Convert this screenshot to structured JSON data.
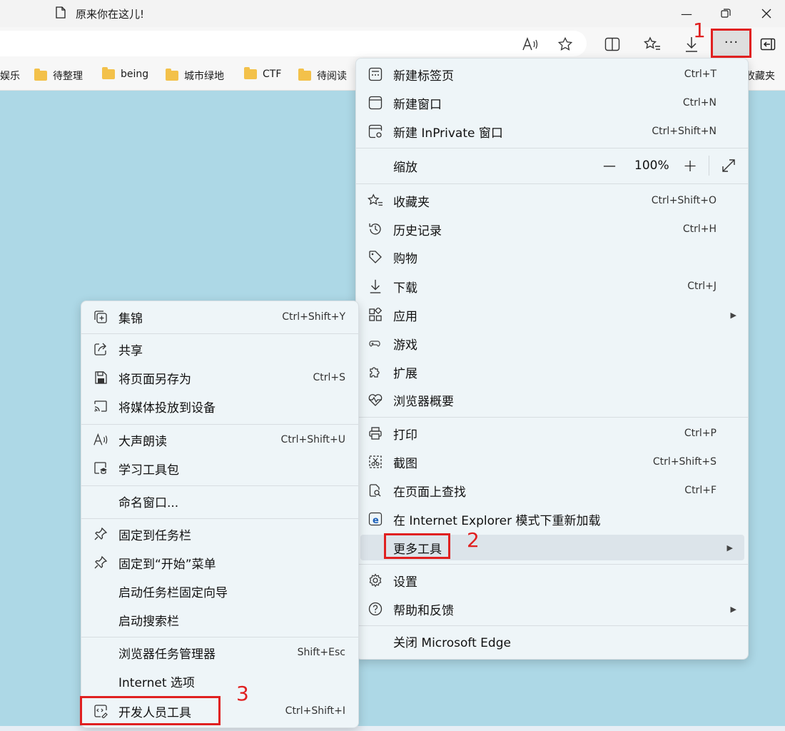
{
  "tab": {
    "title": "原来你在这儿!"
  },
  "favorites": [
    {
      "label": "娱乐"
    },
    {
      "label": "待整理"
    },
    {
      "label": "being"
    },
    {
      "label": "城市绿地"
    },
    {
      "label": "CTF"
    },
    {
      "label": "待阅读"
    },
    {
      "label": "收藏夹"
    }
  ],
  "main_menu": {
    "new_tab": {
      "label": "新建标签页",
      "shortcut": "Ctrl+T"
    },
    "new_window": {
      "label": "新建窗口",
      "shortcut": "Ctrl+N"
    },
    "new_inprivate": {
      "label": "新建 InPrivate 窗口",
      "shortcut": "Ctrl+Shift+N"
    },
    "zoom": {
      "label": "缩放",
      "value": "100%",
      "minus": "—",
      "plus": "+"
    },
    "favorites": {
      "label": "收藏夹",
      "shortcut": "Ctrl+Shift+O"
    },
    "history": {
      "label": "历史记录",
      "shortcut": "Ctrl+H"
    },
    "shopping": {
      "label": "购物"
    },
    "downloads": {
      "label": "下载",
      "shortcut": "Ctrl+J"
    },
    "apps": {
      "label": "应用"
    },
    "games": {
      "label": "游戏"
    },
    "extensions": {
      "label": "扩展"
    },
    "browser_essentials": {
      "label": "浏览器概要"
    },
    "print": {
      "label": "打印",
      "shortcut": "Ctrl+P"
    },
    "screenshot": {
      "label": "截图",
      "shortcut": "Ctrl+Shift+S"
    },
    "find": {
      "label": "在页面上查找",
      "shortcut": "Ctrl+F"
    },
    "ie_mode": {
      "label": "在 Internet Explorer 模式下重新加载"
    },
    "more_tools": {
      "label": "更多工具"
    },
    "settings": {
      "label": "设置"
    },
    "help": {
      "label": "帮助和反馈"
    },
    "close": {
      "label": "关闭 Microsoft Edge"
    }
  },
  "sub_menu": {
    "collections": {
      "label": "集锦",
      "shortcut": "Ctrl+Shift+Y"
    },
    "share": {
      "label": "共享"
    },
    "save_as": {
      "label": "将页面另存为",
      "shortcut": "Ctrl+S"
    },
    "cast": {
      "label": "将媒体投放到设备"
    },
    "read_aloud": {
      "label": "大声朗读",
      "shortcut": "Ctrl+Shift+U"
    },
    "learning": {
      "label": "学习工具包"
    },
    "name_window": {
      "label": "命名窗口..."
    },
    "pin_taskbar": {
      "label": "固定到任务栏"
    },
    "pin_start": {
      "label": "固定到“开始”菜单"
    },
    "taskbar_wizard": {
      "label": "启动任务栏固定向导"
    },
    "search_bar": {
      "label": "启动搜索栏"
    },
    "task_manager": {
      "label": "浏览器任务管理器",
      "shortcut": "Shift+Esc"
    },
    "internet_options": {
      "label": "Internet 选项"
    },
    "devtools": {
      "label": "开发人员工具",
      "shortcut": "Ctrl+Shift+I"
    }
  },
  "annotations": {
    "step1": "1",
    "step2": "2",
    "step3": "3"
  },
  "colors": {
    "page_bg": "#add8e6",
    "menu_bg": "#eef5f8",
    "annotation_red": "#e02020",
    "folder": "#f3c14a"
  }
}
